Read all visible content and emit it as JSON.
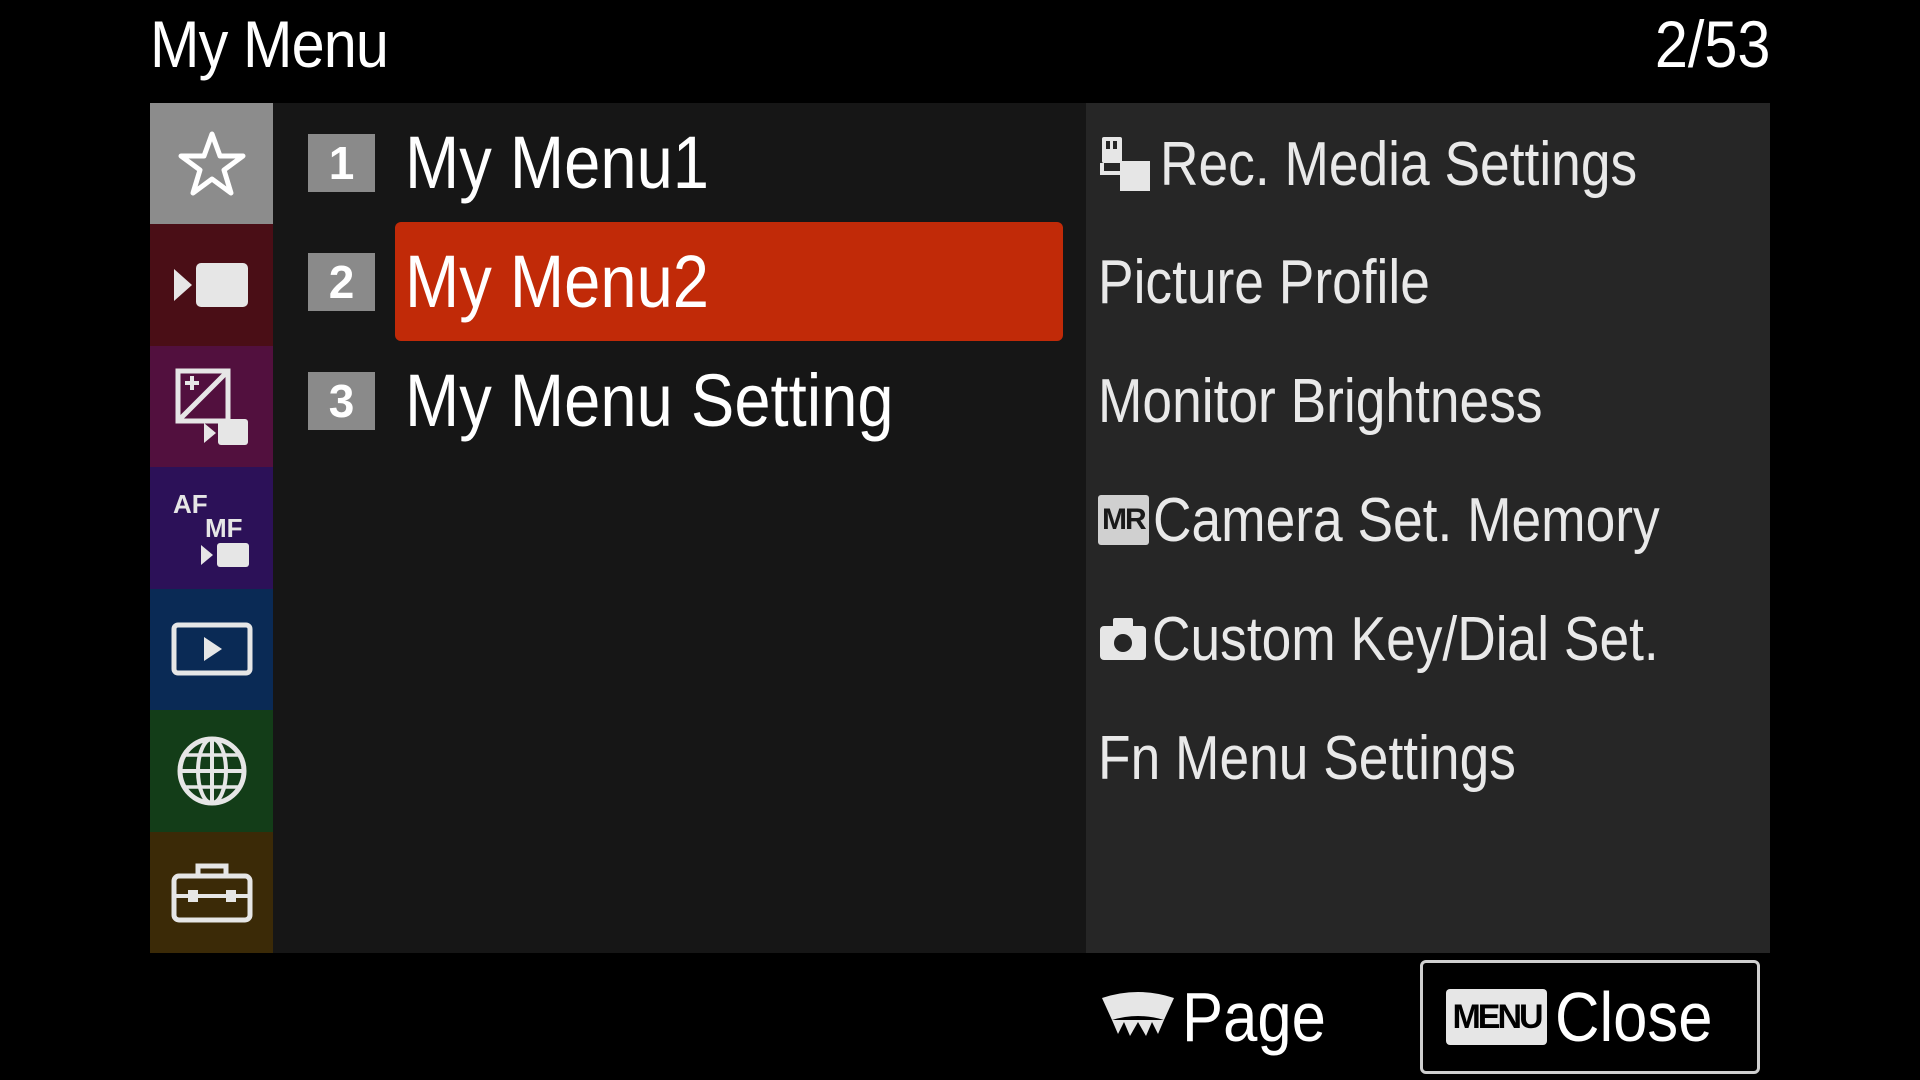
{
  "header": {
    "title": "My Menu",
    "page_counter": "2/53"
  },
  "tabs": [
    {
      "icon": "star-icon",
      "color": "#8c8c8c",
      "selected": true
    },
    {
      "icon": "movie-camera-icon",
      "color": "#4a0e16"
    },
    {
      "icon": "exposure-image-icon",
      "color": "#52103e"
    },
    {
      "icon": "af-mf-icon",
      "color": "#2c1158",
      "text_af": "AF",
      "text_mf": "MF"
    },
    {
      "icon": "playback-icon",
      "color": "#0a2a55"
    },
    {
      "icon": "globe-icon",
      "color": "#133d18"
    },
    {
      "icon": "toolbox-icon",
      "color": "#3b2a07"
    }
  ],
  "menu_rows": [
    {
      "number": "1",
      "label": "My Menu1"
    },
    {
      "number": "2",
      "label": "My Menu2",
      "selected": true
    },
    {
      "number": "3",
      "label": "My Menu Setting"
    }
  ],
  "submenu_items": [
    {
      "icon": "rec-media-icon",
      "label": "Rec. Media Settings"
    },
    {
      "icon": "",
      "label": "Picture Profile"
    },
    {
      "icon": "",
      "label": "Monitor Brightness"
    },
    {
      "icon": "mr-icon",
      "icon_text": "MR",
      "label": "Camera Set. Memory"
    },
    {
      "icon": "camera-icon",
      "label": "Custom Key/Dial Set."
    },
    {
      "icon": "",
      "label": "Fn Menu Settings"
    }
  ],
  "footer": {
    "page_icon": "control-wheel-icon",
    "page_label": "Page",
    "close_badge": "MENU",
    "close_label": "Close"
  },
  "colors": {
    "selection": "#c12a08",
    "middle_panel": "#161616",
    "right_panel": "#262626"
  }
}
